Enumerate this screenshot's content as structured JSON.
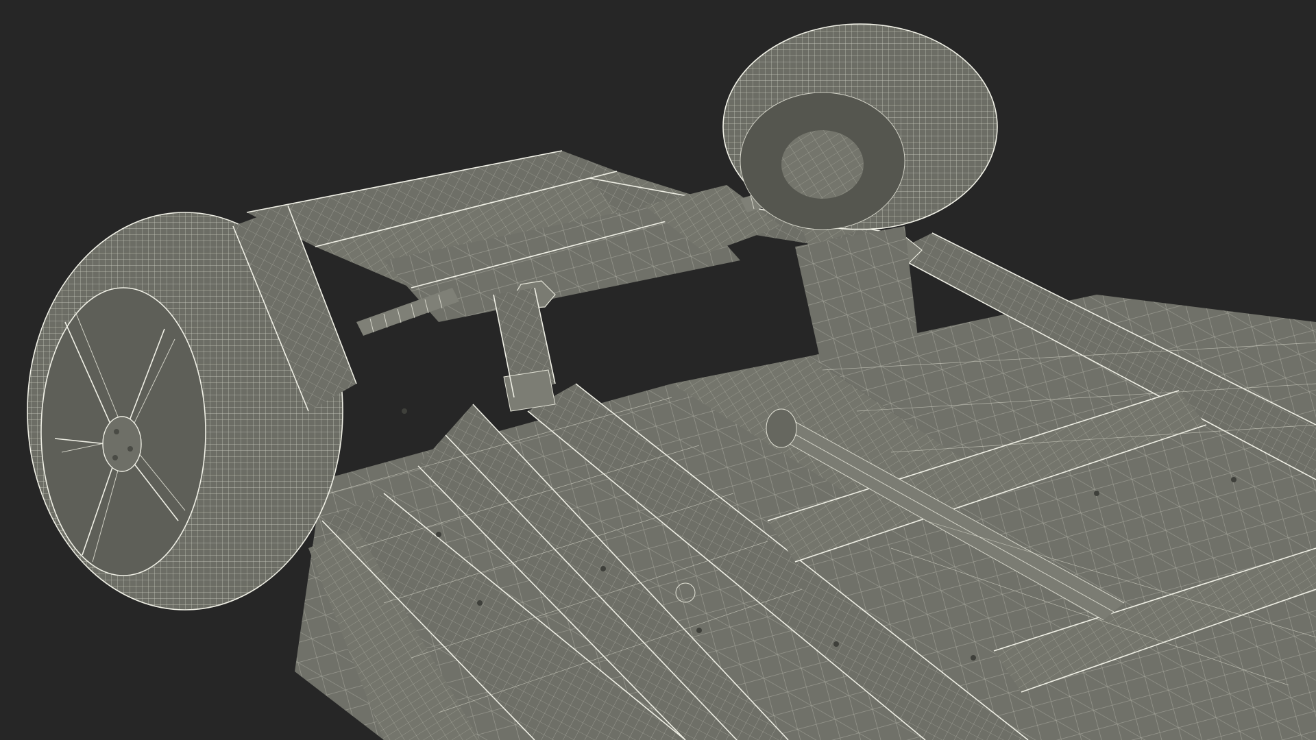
{
  "scene": {
    "background_color": "#262626",
    "mesh_color": "#6f7068",
    "wire_color": "#e4e4d8",
    "subject": "car-chassis-wireframe-underside"
  }
}
